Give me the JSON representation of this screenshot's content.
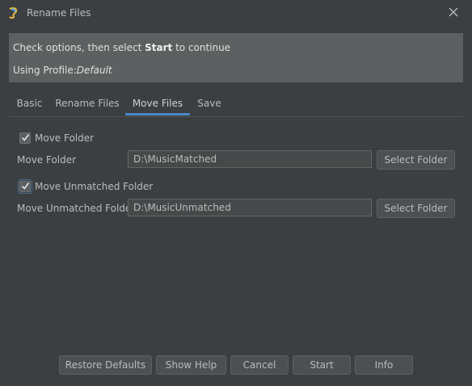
{
  "window": {
    "title": "Rename Files",
    "icon": "app-logo-icon",
    "close_icon": "close-icon"
  },
  "banner": {
    "line1_before": "Check options, then select ",
    "line1_bold": "Start",
    "line1_after": " to continue",
    "line2_label": "Using Profile:",
    "line2_value": "Default"
  },
  "tabs": [
    {
      "label": "Basic",
      "active": false
    },
    {
      "label": "Rename Files",
      "active": false
    },
    {
      "label": "Move Files",
      "active": true
    },
    {
      "label": "Save",
      "active": false
    }
  ],
  "move_folder": {
    "checkbox_label": "Move Folder",
    "checked": true,
    "field_label": "Move Folder",
    "path": "D:\\MusicMatched",
    "button_label": "Select Folder"
  },
  "move_unmatched": {
    "checkbox_label": "Move Unmatched Folder",
    "checked": true,
    "field_label": "Move Unmatched Folder",
    "path": "D:\\MusicUnmatched",
    "button_label": "Select Folder"
  },
  "footer_buttons": {
    "restore_defaults": "Restore Defaults",
    "show_help": "Show Help",
    "cancel": "Cancel",
    "start": "Start",
    "info": "Info"
  },
  "colors": {
    "background": "#3c3f41",
    "banner": "#5d6061",
    "tab_accent": "#4a88c7"
  }
}
